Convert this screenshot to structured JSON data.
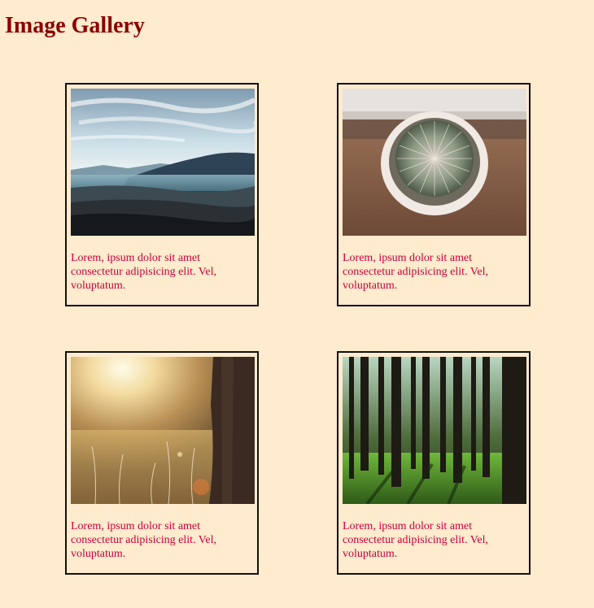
{
  "page": {
    "title": "Image Gallery"
  },
  "gallery": {
    "items": [
      {
        "image": "mountain-landscape",
        "caption": "Lorem, ipsum dolor sit amet consectetur adipisicing elit. Vel, voluptatum."
      },
      {
        "image": "potted-cactus",
        "caption": "Lorem, ipsum dolor sit amet consectetur adipisicing elit. Vel, voluptatum."
      },
      {
        "image": "sunlit-meadow",
        "caption": "Lorem, ipsum dolor sit amet consectetur adipisicing elit. Vel, voluptatum."
      },
      {
        "image": "pine-forest",
        "caption": "Lorem, ipsum dolor sit amet consectetur adipisicing elit. Vel, voluptatum."
      }
    ]
  },
  "colors": {
    "background": "#ffebcd",
    "title": "#8b0000",
    "caption": "#c8003c",
    "card_border": "#111111"
  }
}
